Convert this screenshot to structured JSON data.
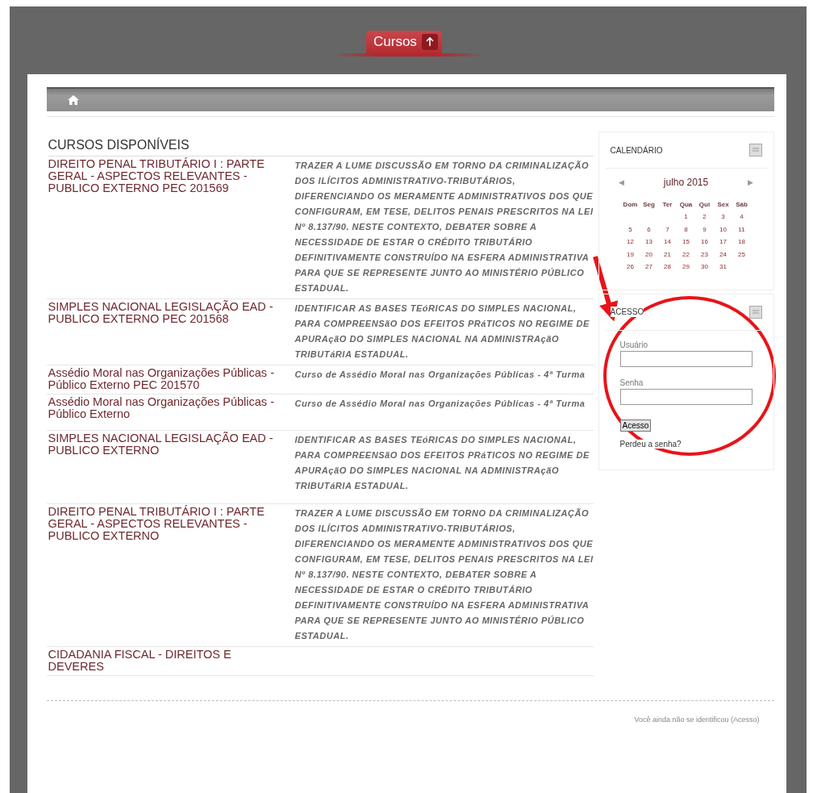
{
  "header_tab": {
    "label": "Cursos"
  },
  "courses": {
    "title": "CURSOS DISPONÍVEIS",
    "rows": [
      {
        "name": "DIREITO PENAL TRIBUTÁRIO I : PARTE GERAL - ASPECTOS RELEVANTES - PUBLICO EXTERNO PEC 201569",
        "description": "TRAZER A LUME DISCUSSÃO EM TORNO DA CRIMINALIZAÇÃO DOS ILÍCITOS ADMINISTRATIVO-TRIBUTÁRIOS, DIFERENCIANDO OS MERAMENTE ADMINISTRATIVOS DOS QUE CONFIGURAM, EM TESE, DELITOS PENAIS PRESCRITOS NA LEI Nº 8.137/90. NESTE CONTEXTO, DEBATER SOBRE A NECESSIDADE DE ESTAR O CRÉDITO TRIBUTÁRIO DEFINITIVAMENTE CONSTRUÍDO NA ESFERA ADMINISTRATIVA PARA QUE SE REPRESENTE JUNTO AO MINISTÉRIO PÚBLICO ESTADUAL."
      },
      {
        "name": "SIMPLES NACIONAL LEGISLAÇÃO EAD - PUBLICO EXTERNO PEC 201568",
        "description": "IDENTIFICAR AS BASES TEóRICAS DO SIMPLES NACIONAL, PARA COMPREENSãO DOS EFEITOS PRáTICOS NO REGIME DE APURAçãO DO SIMPLES NACIONAL NA ADMINISTRAçãO TRIBUTáRIA ESTADUAL."
      },
      {
        "name": "Assédio Moral nas Organizações Públicas - Público Externo PEC 201570",
        "description": "Curso de Assédio Moral nas Organizações Públicas - 4ª Turma"
      },
      {
        "name": "Assédio Moral nas Organizações Públicas - Público Externo",
        "description": "Curso de Assédio Moral nas Organizações Públicas - 4ª Turma"
      },
      {
        "name": "SIMPLES NACIONAL LEGISLAÇÃO EAD - PUBLICO EXTERNO",
        "description": "IDENTIFICAR AS BASES TEóRICAS DO SIMPLES NACIONAL, PARA COMPREENSãO DOS EFEITOS PRáTICOS NO REGIME DE APURAçãO DO SIMPLES NACIONAL NA ADMINISTRAçãO TRIBUTáRIA ESTADUAL."
      },
      {
        "name": "DIREITO PENAL TRIBUTÁRIO I : PARTE GERAL - ASPECTOS RELEVANTES - PUBLICO EXTERNO",
        "description": "TRAZER A LUME DISCUSSÃO EM TORNO DA CRIMINALIZAÇÃO DOS ILÍCITOS ADMINISTRATIVO-TRIBUTÁRIOS, DIFERENCIANDO OS MERAMENTE ADMINISTRATIVOS DOS QUE CONFIGURAM, EM TESE, DELITOS PENAIS PRESCRITOS NA LEI Nº 8.137/90. NESTE CONTEXTO, DEBATER SOBRE A NECESSIDADE DE ESTAR O CRÉDITO TRIBUTÁRIO DEFINITIVAMENTE CONSTRUÍDO NA ESFERA ADMINISTRATIVA PARA QUE SE REPRESENTE JUNTO AO MINISTÉRIO PÚBLICO ESTADUAL."
      },
      {
        "name": "CIDADANIA FISCAL - DIREITOS E DEVERES"
      }
    ]
  },
  "calendar": {
    "title": "CALENDÁRIO",
    "previous": "◀",
    "month": "julho 2015",
    "next": "▶",
    "weekdays": [
      "Dom",
      "Seg",
      "Ter",
      "Qua",
      "Qui",
      "Sex",
      "Sáb"
    ],
    "weeks": [
      [
        "1",
        "2",
        "3",
        "4"
      ],
      [
        "5",
        "6",
        "7",
        "8",
        "9",
        "10",
        "11"
      ],
      [
        "12",
        "13",
        "14",
        "15",
        "16",
        "17",
        "18"
      ],
      [
        "19",
        "20",
        "21",
        "22",
        "23",
        "24",
        "25"
      ],
      [
        "26",
        "27",
        "28",
        "29",
        "30",
        "31"
      ]
    ]
  },
  "login": {
    "title": "ACESSO",
    "fields": [
      {
        "label": "Usuário"
      },
      {
        "label": "Senha"
      }
    ],
    "button": "Acesso",
    "link": "Perdeu a senha?"
  },
  "footer": {
    "text": "Você ainda não se identificou",
    "link": "(Acesso)"
  }
}
